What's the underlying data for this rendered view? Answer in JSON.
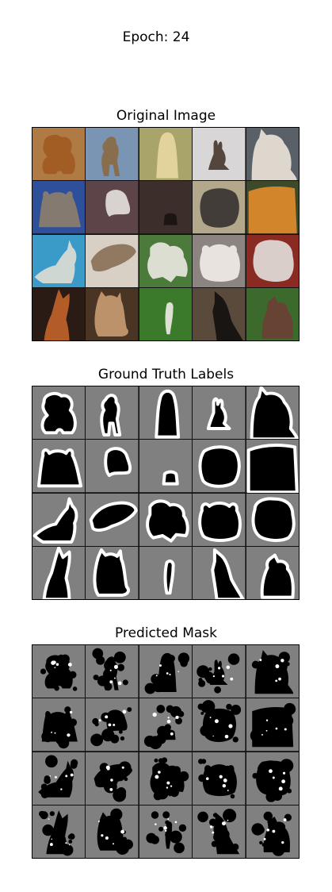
{
  "figure": {
    "suptitle": "Epoch: 24"
  },
  "panels": {
    "original": {
      "title": "Original Image"
    },
    "ground_truth": {
      "title": "Ground Truth Labels"
    },
    "predicted": {
      "title": "Predicted Mask"
    }
  },
  "colors": {
    "background_gray": "#808080",
    "mask_fill": "#000000",
    "mask_outline": "#ffffff"
  },
  "grid": {
    "rows": 4,
    "cols": 5
  },
  "original_cells": [
    {
      "subject": "dog",
      "bg": "#b07a45",
      "fg": "#a15a22"
    },
    {
      "subject": "dog",
      "bg": "#7a94b4",
      "fg": "#8a6a45"
    },
    {
      "subject": "dog",
      "bg": "#a8a46a",
      "fg": "#e6d7a0"
    },
    {
      "subject": "dog",
      "bg": "#d9d6d8",
      "fg": "#4a3a30"
    },
    {
      "subject": "cat",
      "bg": "#5a6068",
      "fg": "#e8e2d6"
    },
    {
      "subject": "cat",
      "bg": "#2e4f9a",
      "fg": "#8c7e6c"
    },
    {
      "subject": "dog",
      "bg": "#5c4448",
      "fg": "#e4e0dc"
    },
    {
      "subject": "dog",
      "bg": "#3c2e2a",
      "fg": "#1a1410"
    },
    {
      "subject": "dog",
      "bg": "#b4a88c",
      "fg": "#3a3432"
    },
    {
      "subject": "dog",
      "bg": "#3c4a2a",
      "fg": "#e08a2a"
    },
    {
      "subject": "cat",
      "bg": "#3a9ac8",
      "fg": "#dcdcd2"
    },
    {
      "subject": "cat",
      "bg": "#d8d0c4",
      "fg": "#8a7058"
    },
    {
      "subject": "dog",
      "bg": "#4c7a3a",
      "fg": "#e8e6e0"
    },
    {
      "subject": "dog",
      "bg": "#8c8480",
      "fg": "#f0ece6"
    },
    {
      "subject": "dog",
      "bg": "#8a2a22",
      "fg": "#e0dcd8"
    },
    {
      "subject": "dog",
      "bg": "#2a1c14",
      "fg": "#c0622a"
    },
    {
      "subject": "cat",
      "bg": "#4a3424",
      "fg": "#c49a70"
    },
    {
      "subject": "dog",
      "bg": "#3a7a2a",
      "fg": "#ece8e2"
    },
    {
      "subject": "cat",
      "bg": "#5a4a3c",
      "fg": "#121010"
    },
    {
      "subject": "dog",
      "bg": "#3c6a2c",
      "fg": "#6a4034"
    }
  ]
}
